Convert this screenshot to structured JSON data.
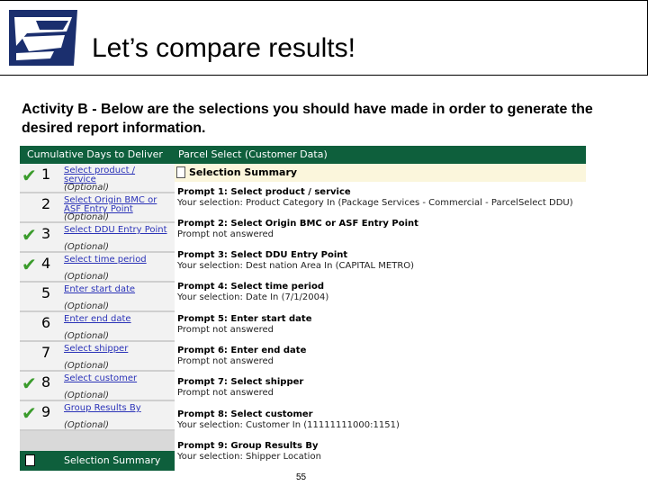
{
  "slide": {
    "title": "Let’s compare results!",
    "subtitle": "Activity B - Below are the selections you should have made in order to generate the desired report information.",
    "page_number": "55"
  },
  "screen": {
    "header_left": "Cumulative Days to Deliver",
    "header_right": "Parcel Select (Customer Data)",
    "selection_summary_heading": "Selection Summary",
    "summary_button_label": "Selection Summary",
    "prompts": [
      {
        "number": "1",
        "checked": true,
        "link": "Select product /",
        "link2": "service",
        "optional": "(Optional)"
      },
      {
        "number": "2",
        "checked": false,
        "link": "Select Origin BMC or",
        "link2": "ASF Entry Point",
        "optional": "(Optional)"
      },
      {
        "number": "3",
        "checked": true,
        "link": "Select DDU Entry Point",
        "link2": "",
        "optional": "(Optional)"
      },
      {
        "number": "4",
        "checked": true,
        "link": "Select time period",
        "link2": "",
        "optional": "(Optional)"
      },
      {
        "number": "5",
        "checked": false,
        "link": "Enter start date",
        "link2": "",
        "optional": "(Optional)"
      },
      {
        "number": "6",
        "checked": false,
        "link": "Enter end date",
        "link2": "",
        "optional": "(Optional)"
      },
      {
        "number": "7",
        "checked": false,
        "link": "Select shipper",
        "link2": "",
        "optional": "(Optional)"
      },
      {
        "number": "8",
        "checked": true,
        "link": "Select customer",
        "link2": "",
        "optional": "(Optional)"
      },
      {
        "number": "9",
        "checked": true,
        "link": "Group Results By",
        "link2": "",
        "optional": "(Optional)"
      }
    ],
    "results": [
      {
        "title": "Prompt 1: Select product / service",
        "value": "Your selection: Product Category In (Package Services - Commercial - ParcelSelect DDU)"
      },
      {
        "title": "Prompt 2: Select Origin BMC or ASF Entry Point",
        "value": "Prompt not answered"
      },
      {
        "title": "Prompt 3: Select DDU Entry Point",
        "value": "Your selection: Dest nation Area In (CAPITAL METRO)"
      },
      {
        "title": "Prompt 4: Select time period",
        "value": "Your selection: Date In (7/1/2004)"
      },
      {
        "title": "Prompt 5: Enter start date",
        "value": "Prompt not answered"
      },
      {
        "title": "Prompt 6: Enter end date",
        "value": "Prompt not answered"
      },
      {
        "title": "Prompt 7: Select shipper",
        "value": "Prompt not answered"
      },
      {
        "title": "Prompt 8: Select customer",
        "value": "Your selection: Customer In (11111111000:1151)"
      },
      {
        "title": "Prompt 9: Group Results By",
        "value": "Your selection: Shipper Location"
      }
    ],
    "colors": {
      "header_bg": "#0e5f3c",
      "check": "#3a9b2b",
      "link": "#2b33b8",
      "summary_head_bg": "#fbf6dc"
    },
    "icons": {
      "check": "check-icon",
      "document": "document-icon"
    }
  }
}
